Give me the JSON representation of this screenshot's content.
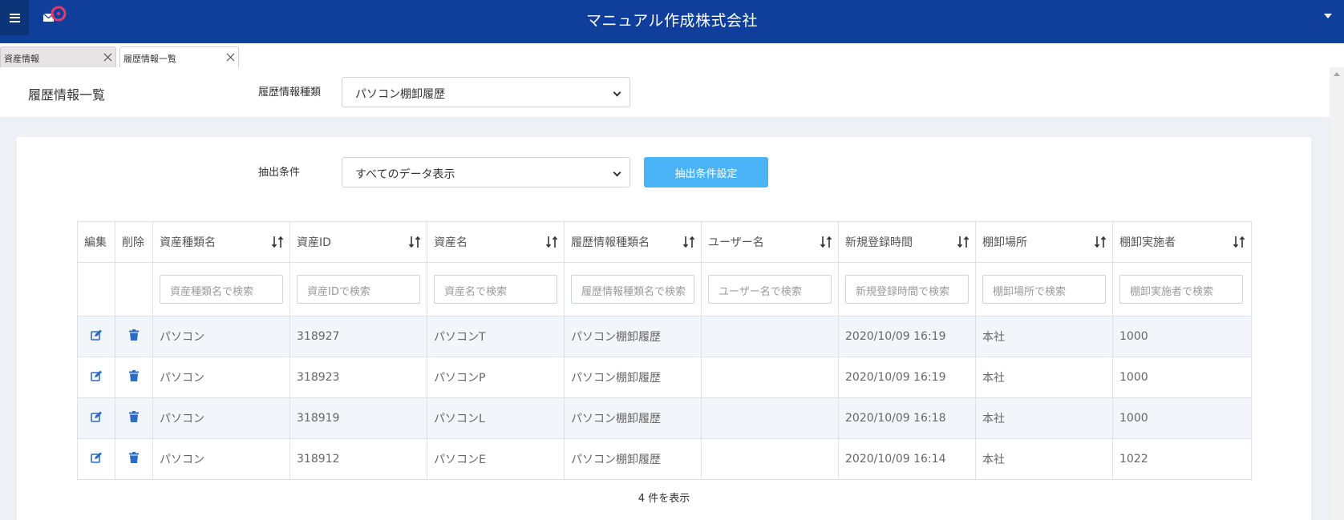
{
  "colors": {
    "topbar": "#0f3f9b",
    "accent_button": "#4bb4f6",
    "icon": "#2c6cc4"
  },
  "header": {
    "app_title": "マニュアル作成株式会社"
  },
  "tabs": [
    {
      "label": "資産情報"
    },
    {
      "label": "履歴情報一覧"
    }
  ],
  "page": {
    "title": "履歴情報一覧",
    "type_label": "履歴情報種類",
    "type_value": "パソコン棚卸履歴"
  },
  "filter": {
    "label": "抽出条件",
    "value": "すべてのデータ表示",
    "button": "抽出条件設定"
  },
  "table": {
    "columns": [
      "編集",
      "削除",
      "資産種類名",
      "資産ID",
      "資産名",
      "履歴情報種類名",
      "ユーザー名",
      "新規登録時間",
      "棚卸場所",
      "棚卸実施者"
    ],
    "search_placeholders": [
      "資産種類名で検索",
      "資産IDで検索",
      "資産名で検索",
      "履歴情報種類名で検索",
      "ユーザー名で検索",
      "新規登録時間で検索",
      "棚卸場所で検索",
      "棚卸実施者で検索"
    ],
    "rows": [
      [
        "パソコン",
        "318927",
        "パソコンT",
        "パソコン棚卸履歴",
        "",
        "2020/10/09 16:19",
        "本社",
        "1000"
      ],
      [
        "パソコン",
        "318923",
        "パソコンP",
        "パソコン棚卸履歴",
        "",
        "2020/10/09 16:19",
        "本社",
        "1000"
      ],
      [
        "パソコン",
        "318919",
        "パソコンL",
        "パソコン棚卸履歴",
        "",
        "2020/10/09 16:18",
        "本社",
        "1000"
      ],
      [
        "パソコン",
        "318912",
        "パソコンE",
        "パソコン棚卸履歴",
        "",
        "2020/10/09 16:14",
        "本社",
        "1022"
      ]
    ],
    "footer": "4 件を表示"
  }
}
